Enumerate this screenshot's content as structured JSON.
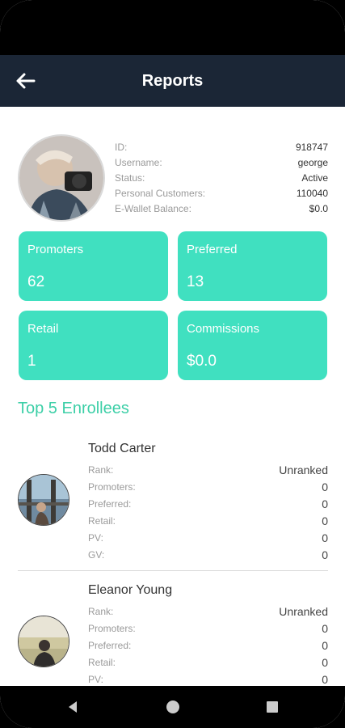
{
  "header": {
    "title": "Reports"
  },
  "profile": {
    "rows": [
      {
        "label": "ID:",
        "value": "918747"
      },
      {
        "label": "Username:",
        "value": "george"
      },
      {
        "label": "Status:",
        "value": "Active"
      },
      {
        "label": "Personal Customers:",
        "value": "110040"
      },
      {
        "label": "E-Wallet Balance:",
        "value": "$0.0"
      }
    ]
  },
  "cards": [
    {
      "label": "Promoters",
      "value": "62"
    },
    {
      "label": "Preferred",
      "value": "13"
    },
    {
      "label": "Retail",
      "value": "1"
    },
    {
      "label": "Commissions",
      "value": "$0.0"
    }
  ],
  "enrollees": {
    "title": "Top 5 Enrollees",
    "items": [
      {
        "name": "Todd Carter",
        "stats": [
          {
            "label": "Rank:",
            "value": "Unranked"
          },
          {
            "label": "Promoters:",
            "value": "0"
          },
          {
            "label": "Preferred:",
            "value": "0"
          },
          {
            "label": "Retail:",
            "value": "0"
          },
          {
            "label": "PV:",
            "value": "0"
          },
          {
            "label": "GV:",
            "value": "0"
          }
        ]
      },
      {
        "name": "Eleanor Young",
        "stats": [
          {
            "label": "Rank:",
            "value": "Unranked"
          },
          {
            "label": "Promoters:",
            "value": "0"
          },
          {
            "label": "Preferred:",
            "value": "0"
          },
          {
            "label": "Retail:",
            "value": "0"
          },
          {
            "label": "PV:",
            "value": "0"
          }
        ]
      }
    ]
  },
  "colors": {
    "appbar": "#1b2636",
    "accent": "#40e0c0",
    "heading": "#3ccfa7"
  },
  "icons": {
    "back": "arrow-left-icon",
    "nav_back": "triangle-back-icon",
    "nav_home": "circle-home-icon",
    "nav_recents": "square-recents-icon"
  }
}
